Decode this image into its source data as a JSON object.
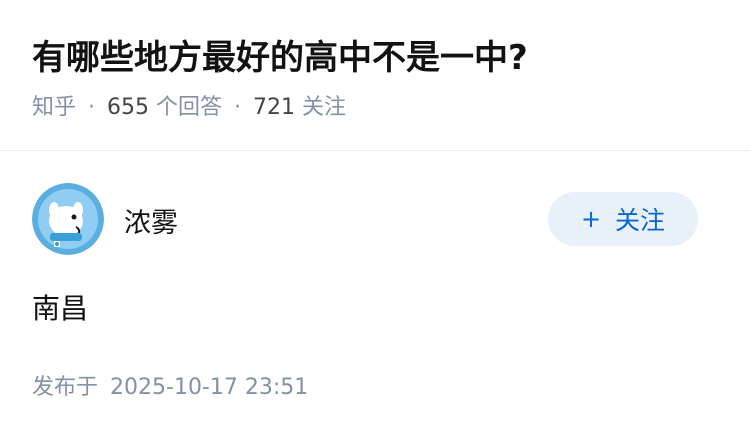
{
  "question": {
    "title": "有哪些地方最好的高中不是一中?",
    "source": "知乎",
    "separator": "·",
    "answer_count": "655",
    "answer_label": "个回答",
    "follower_count": "721",
    "follower_label": "关注"
  },
  "answer": {
    "author_name": "浓雾",
    "follow_plus": "+",
    "follow_label": "关注",
    "content": "南昌",
    "published_label": "发布于",
    "published_time": "2025-10-17 23:51"
  },
  "colors": {
    "accent": "#0d66d0",
    "follow_bg": "#e8f0fa",
    "meta_text": "#8590a6",
    "avatar_bg": "#5aaee0"
  }
}
